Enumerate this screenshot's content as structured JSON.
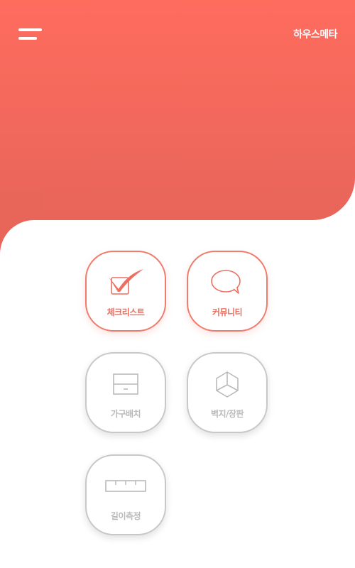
{
  "app": {
    "brand": "하우스메타"
  },
  "menu": {
    "icon": "hamburger-menu-icon"
  },
  "tiles": [
    {
      "label": "체크리스트",
      "icon": "checklist-icon",
      "state": "active"
    },
    {
      "label": "커뮤니티",
      "icon": "speech-bubble-icon",
      "state": "active"
    },
    {
      "label": "가구배치",
      "icon": "furniture-cabinet-icon",
      "state": "inactive"
    },
    {
      "label": "벽지/장판",
      "icon": "cube-icon",
      "state": "inactive"
    },
    {
      "label": "길이측정",
      "icon": "ruler-icon",
      "state": "inactive"
    }
  ],
  "colors": {
    "header_top": "#fe6c5e",
    "header_bottom": "#e8655a",
    "accent": "#ec6f60",
    "inactive_border": "#c8c8c8",
    "inactive_text": "#b9b9b9",
    "background": "#ffffff"
  }
}
